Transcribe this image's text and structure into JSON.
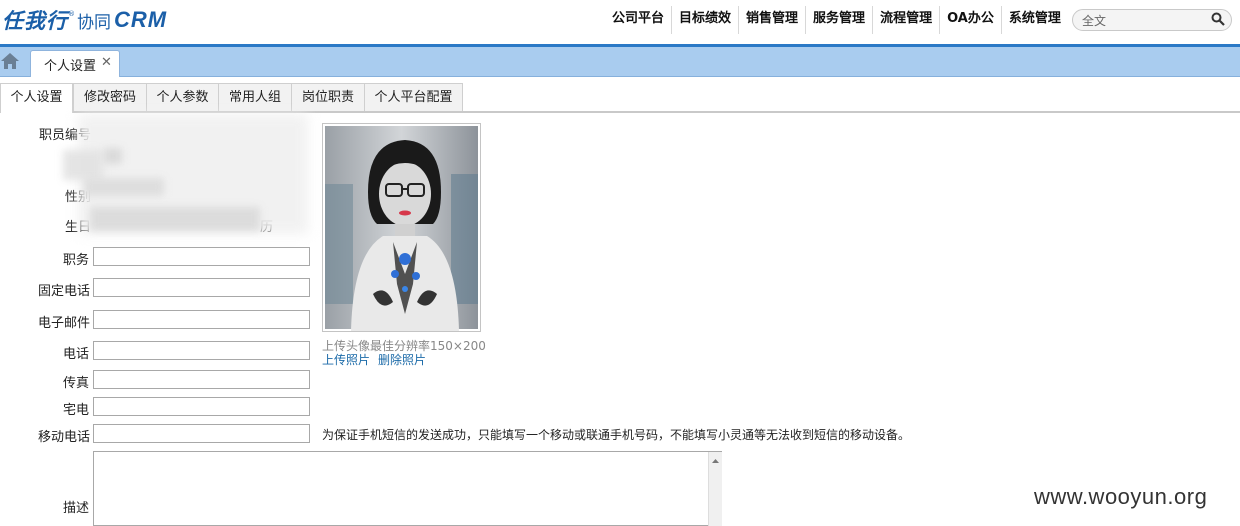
{
  "header": {
    "logo": {
      "main": "任我行",
      "registered": "®",
      "sub": "协同",
      "product": "CRM"
    },
    "nav": [
      "公司平台",
      "目标绩效",
      "销售管理",
      "服务管理",
      "流程管理",
      "OA办公",
      "系统管理"
    ],
    "search": {
      "value": "全文"
    }
  },
  "tabs": {
    "active_tab": "个人设置"
  },
  "subtabs": [
    "个人设置",
    "修改密码",
    "个人参数",
    "常用人组",
    "岗位职责",
    "个人平台配置"
  ],
  "form": {
    "employee_no_label": "职员编号",
    "gender_label": "性别",
    "birthday_label": "生日",
    "calendar_text": "历",
    "position_label": "职务",
    "landline_label": "固定电话",
    "email_label": "电子邮件",
    "phone_label": "电话",
    "fax_label": "传真",
    "home_phone_label": "宅电",
    "mobile_label": "移动电话",
    "description_label": "描述",
    "mobile_note": "为保证手机短信的发送成功，只能填写一个移动或联通手机号码，不能填写小灵通等无法收到短信的移动设备。"
  },
  "photo": {
    "hint": "上传头像最佳分辨率150×200",
    "upload_label": "上传照片",
    "delete_label": "删除照片"
  },
  "watermark": "www.wooyun.org",
  "colors": {
    "brand": "#1b5fa8",
    "header_line": "#2b79c6",
    "tabstrip": "#a9ccef",
    "link": "#1b6aa8"
  }
}
